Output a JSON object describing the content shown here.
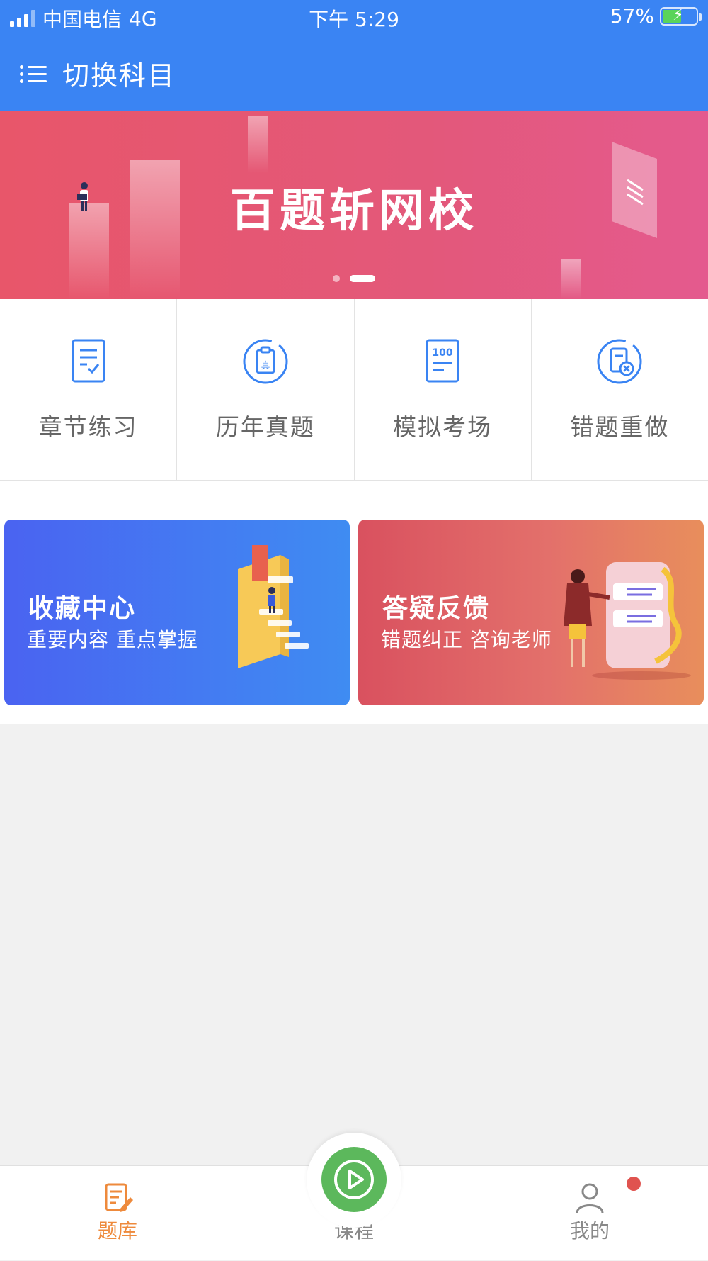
{
  "status_bar": {
    "carrier": "中国电信",
    "network": "4G",
    "time": "下午 5:29",
    "battery_percent": "57%",
    "battery_level": 0.57
  },
  "nav": {
    "title": "切换科目"
  },
  "banner": {
    "title": "百题斩网校",
    "slide_count": 2,
    "active_slide": 2
  },
  "features": [
    {
      "label": "章节练习",
      "icon": "chapter-practice-icon"
    },
    {
      "label": "历年真题",
      "icon": "past-papers-icon"
    },
    {
      "label": "模拟考场",
      "icon": "mock-exam-icon"
    },
    {
      "label": "错题重做",
      "icon": "redo-mistakes-icon"
    }
  ],
  "icon_texts": {
    "real": "真",
    "score": "100"
  },
  "cards": [
    {
      "title": "收藏中心",
      "subtitle": "重要内容 重点掌握"
    },
    {
      "title": "答疑反馈",
      "subtitle": "错题纠正 咨询老师"
    }
  ],
  "tabs": [
    {
      "label": "题库",
      "active": true
    },
    {
      "label": "课程",
      "active": false
    },
    {
      "label": "我的",
      "active": false
    }
  ],
  "colors": {
    "primary": "#3a84f3",
    "banner": "#e3587a",
    "active_tab": "#ee8a3c",
    "play": "#5cb85c",
    "badge": "#e0534f"
  }
}
